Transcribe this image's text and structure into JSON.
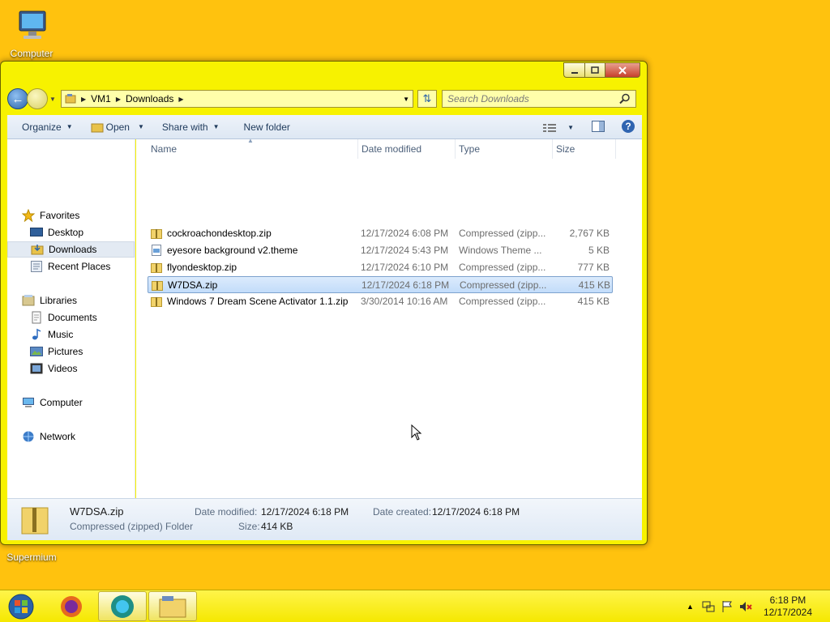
{
  "desktop": {
    "icons": [
      {
        "label": "Computer"
      },
      {
        "label": "Supermium"
      }
    ]
  },
  "window": {
    "controls": {
      "minimize": "minimize-icon",
      "maximize": "maximize-icon",
      "close": "close-icon"
    },
    "address": {
      "crumbs": [
        "VM1",
        "Downloads"
      ]
    },
    "search": {
      "placeholder": "Search Downloads"
    },
    "toolbar": {
      "organize": "Organize",
      "open": "Open",
      "share": "Share with",
      "new_folder": "New folder"
    },
    "nav": {
      "favorites": "Favorites",
      "desktop": "Desktop",
      "downloads": "Downloads",
      "recent": "Recent Places",
      "libraries": "Libraries",
      "documents": "Documents",
      "music": "Music",
      "pictures": "Pictures",
      "videos": "Videos",
      "computer": "Computer",
      "network": "Network",
      "selected": "Downloads"
    },
    "columns": {
      "name": "Name",
      "date": "Date modified",
      "type": "Type",
      "size": "Size"
    },
    "files": [
      {
        "name": "cockroachondesktop.zip",
        "date": "12/17/2024 6:08 PM",
        "type": "Compressed (zipp...",
        "size": "2,767 KB"
      },
      {
        "name": "eyesore background v2.theme",
        "date": "12/17/2024 5:43 PM",
        "type": "Windows Theme ...",
        "size": "5 KB"
      },
      {
        "name": "flyondesktop.zip",
        "date": "12/17/2024 6:10 PM",
        "type": "Compressed (zipp...",
        "size": "777 KB"
      },
      {
        "name": "W7DSA.zip",
        "date": "12/17/2024 6:18 PM",
        "type": "Compressed (zipp...",
        "size": "415 KB"
      },
      {
        "name": "Windows 7 Dream Scene Activator 1.1.zip",
        "date": "3/30/2014 10:16 AM",
        "type": "Compressed (zipp...",
        "size": "415 KB"
      }
    ],
    "selected_file": "W7DSA.zip",
    "details": {
      "name": "W7DSA.zip",
      "kind": "Compressed (zipped) Folder",
      "date_modified_label": "Date modified:",
      "date_modified": "12/17/2024 6:18 PM",
      "date_created_label": "Date created:",
      "date_created": "12/17/2024 6:18 PM",
      "size_label": "Size:",
      "size": "414 KB"
    }
  },
  "taskbar": {
    "clock_time": "6:18 PM",
    "clock_date": "12/17/2024",
    "apps": [
      "firefox-icon",
      "supermium-icon",
      "explorer-icon"
    ]
  },
  "colors": {
    "desktop": "#FFC20E",
    "window_frame": "#F7F200",
    "taskbar": "#F5E800",
    "selection": "#C2DCFA"
  }
}
